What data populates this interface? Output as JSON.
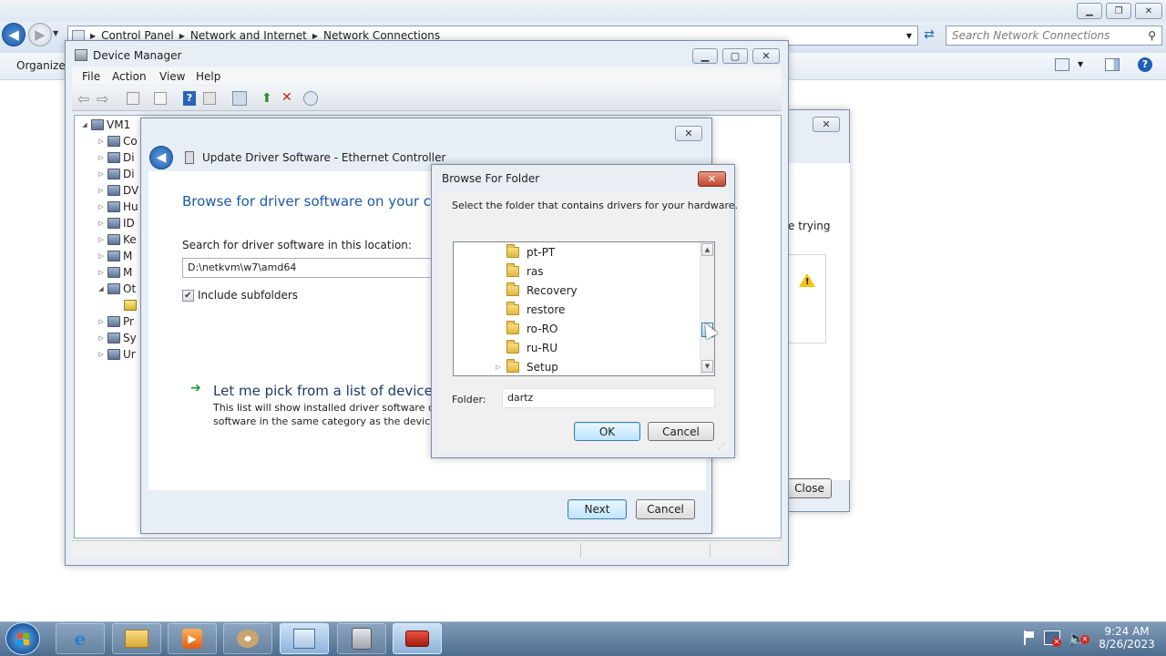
{
  "explorer": {
    "breadcrumbs": [
      "Control Panel",
      "Network and Internet",
      "Network Connections"
    ],
    "search_placeholder": "Search Network Connections",
    "toolbar": {
      "organize": "Organize"
    }
  },
  "background_dialog": {
    "partial_text": "e trying",
    "close_label": "Close"
  },
  "device_manager": {
    "title": "Device Manager",
    "menu": [
      "File",
      "Action",
      "View",
      "Help"
    ],
    "tree_root": "VM1",
    "tree_items": [
      "Co",
      "Di",
      "Di",
      "DV",
      "Hu",
      "ID",
      "Ke",
      "M",
      "M",
      "Ot",
      "",
      "Pr",
      "Sy",
      "Ur"
    ]
  },
  "update_driver": {
    "title": "Update Driver Software - Ethernet Controller",
    "heading": "Browse for driver software on your com",
    "search_label": "Search for driver software in this location:",
    "path_value": "D:\\netkvm\\w7\\amd64",
    "include_subfolders_label": "Include subfolders",
    "include_subfolders_checked": true,
    "pick_link": "Let me pick from a list of device dri",
    "pick_desc_line1": "This list will show installed driver software cor",
    "pick_desc_line2": "software in the same category as the device.",
    "next_label": "Next",
    "cancel_label": "Cancel"
  },
  "browse_folder": {
    "title": "Browse For Folder",
    "instruction": "Select the folder that contains drivers for your hardware.",
    "folders": [
      {
        "name": "pt-PT",
        "expandable": false
      },
      {
        "name": "ras",
        "expandable": false
      },
      {
        "name": "Recovery",
        "expandable": false
      },
      {
        "name": "restore",
        "expandable": false
      },
      {
        "name": "ro-RO",
        "expandable": false
      },
      {
        "name": "ru-RU",
        "expandable": false
      },
      {
        "name": "Setup",
        "expandable": true
      }
    ],
    "folder_label": "Folder:",
    "folder_value": "dartz",
    "ok_label": "OK",
    "cancel_label": "Cancel"
  },
  "taskbar": {
    "time": "9:24 AM",
    "date": "8/26/2023",
    "apps": [
      "internet-explorer",
      "file-explorer",
      "media-player",
      "paint",
      "control-panel",
      "device-manager",
      "toolbox"
    ]
  }
}
